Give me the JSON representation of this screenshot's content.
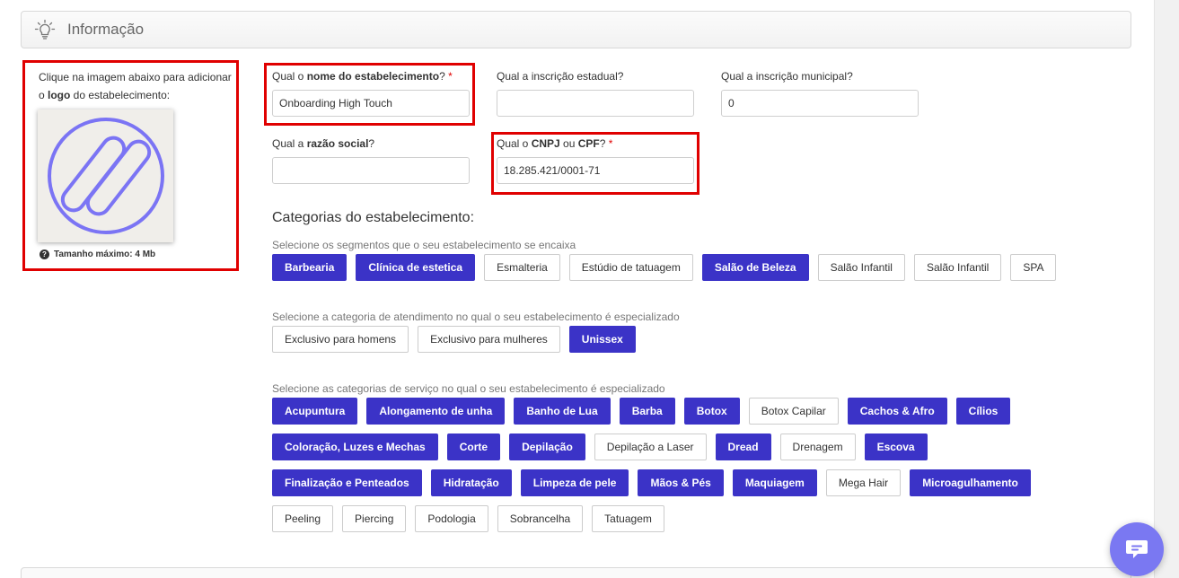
{
  "section": {
    "title": "Informação",
    "icon": "lightbulb-icon"
  },
  "logo": {
    "text_a": "Clique na imagem abaixo para adicionar o ",
    "text_b": "logo",
    "text_c": " do estabelecimento:",
    "size_hint": "Tamanho máximo: 4 Mb"
  },
  "fields": {
    "nome": {
      "label_a": "Qual o ",
      "label_b": "nome do estabelecimento",
      "label_c": "?",
      "required": "*",
      "value": "Onboarding High Touch"
    },
    "inscricao_estadual": {
      "label": "Qual a inscrição estadual?",
      "value": ""
    },
    "inscricao_municipal": {
      "label": "Qual a inscrição municipal?",
      "value": "0"
    },
    "razao": {
      "label_a": "Qual a ",
      "label_b": "razão social",
      "label_c": "?",
      "value": ""
    },
    "cnpj": {
      "label_a": "Qual o ",
      "label_b": "CNPJ",
      "label_c": " ou ",
      "label_d": "CPF",
      "label_e": "?",
      "required": "*",
      "value": "18.285.421/0001-71"
    }
  },
  "categories": {
    "title": "Categorias do estabelecimento:",
    "segments": {
      "hint": "Selecione os segmentos que o seu estabelecimento se encaixa",
      "items": [
        {
          "label": "Barbearia",
          "selected": true
        },
        {
          "label": "Clínica de estetica",
          "selected": true
        },
        {
          "label": "Esmalteria",
          "selected": false
        },
        {
          "label": "Estúdio de tatuagem",
          "selected": false
        },
        {
          "label": "Salão de Beleza",
          "selected": true
        },
        {
          "label": "Salão Infantil",
          "selected": false
        },
        {
          "label": "Salão Infantil",
          "selected": false
        },
        {
          "label": "SPA",
          "selected": false
        }
      ]
    },
    "attendance": {
      "hint": "Selecione a categoria de atendimento no qual o seu estabelecimento é especializado",
      "items": [
        {
          "label": "Exclusivo para homens",
          "selected": false
        },
        {
          "label": "Exclusivo para mulheres",
          "selected": false
        },
        {
          "label": "Unissex",
          "selected": true
        }
      ]
    },
    "services": {
      "hint": "Selecione as categorias de serviço no qual o seu estabelecimento é especializado",
      "rows": [
        [
          {
            "label": "Acupuntura",
            "selected": true
          },
          {
            "label": "Alongamento de unha",
            "selected": true
          },
          {
            "label": "Banho de Lua",
            "selected": true
          },
          {
            "label": "Barba",
            "selected": true
          },
          {
            "label": "Botox",
            "selected": true
          },
          {
            "label": "Botox Capilar",
            "selected": false
          },
          {
            "label": "Cachos & Afro",
            "selected": true
          },
          {
            "label": "Cílios",
            "selected": true
          }
        ],
        [
          {
            "label": "Coloração, Luzes e Mechas",
            "selected": true
          },
          {
            "label": "Corte",
            "selected": true
          },
          {
            "label": "Depilação",
            "selected": true
          },
          {
            "label": "Depilação a Laser",
            "selected": false
          },
          {
            "label": "Dread",
            "selected": true
          },
          {
            "label": "Drenagem",
            "selected": false
          },
          {
            "label": "Escova",
            "selected": true
          }
        ],
        [
          {
            "label": "Finalização e Penteados",
            "selected": true
          },
          {
            "label": "Hidratação",
            "selected": true
          },
          {
            "label": "Limpeza de pele",
            "selected": true
          },
          {
            "label": "Mãos & Pés",
            "selected": true
          },
          {
            "label": "Maquiagem",
            "selected": true
          },
          {
            "label": "Mega Hair",
            "selected": false
          },
          {
            "label": "Microagulhamento",
            "selected": true
          }
        ],
        [
          {
            "label": "Peeling",
            "selected": false
          },
          {
            "label": "Piercing",
            "selected": false
          },
          {
            "label": "Podologia",
            "selected": false
          },
          {
            "label": "Sobrancelha",
            "selected": false
          },
          {
            "label": "Tatuagem",
            "selected": false
          }
        ]
      ]
    }
  },
  "colors": {
    "accent": "#3b33c7",
    "highlight": "#e00000",
    "chat": "#7a78f2",
    "logo_stroke": "#7b74f4"
  },
  "chat": {
    "icon": "chat-bubble-icon"
  }
}
